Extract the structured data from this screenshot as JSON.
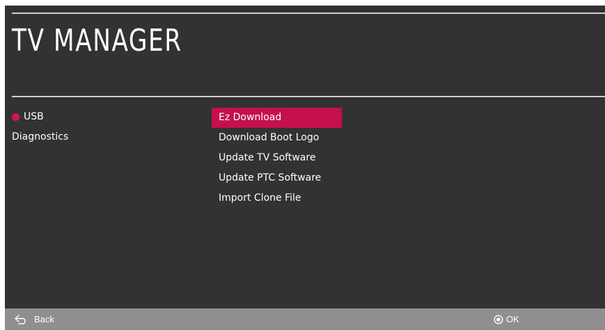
{
  "page": {
    "title": "TV MANAGER"
  },
  "left_menu": {
    "items": [
      {
        "label": "USB",
        "active": true
      },
      {
        "label": "Diagnostics",
        "active": false
      }
    ]
  },
  "right_menu": {
    "items": [
      {
        "label": "Ez Download",
        "selected": true
      },
      {
        "label": "Download Boot Logo",
        "selected": false
      },
      {
        "label": "Update TV Software",
        "selected": false
      },
      {
        "label": "Update PTC Software",
        "selected": false
      },
      {
        "label": "Import Clone File",
        "selected": false
      }
    ]
  },
  "footer": {
    "back_label": "Back",
    "back_icon": "back-arrow-icon",
    "ok_label": "OK",
    "ok_icon": "ok-button-icon"
  },
  "colors": {
    "background": "#323232",
    "accent": "#c4114b",
    "footer": "#8f8f8f"
  }
}
